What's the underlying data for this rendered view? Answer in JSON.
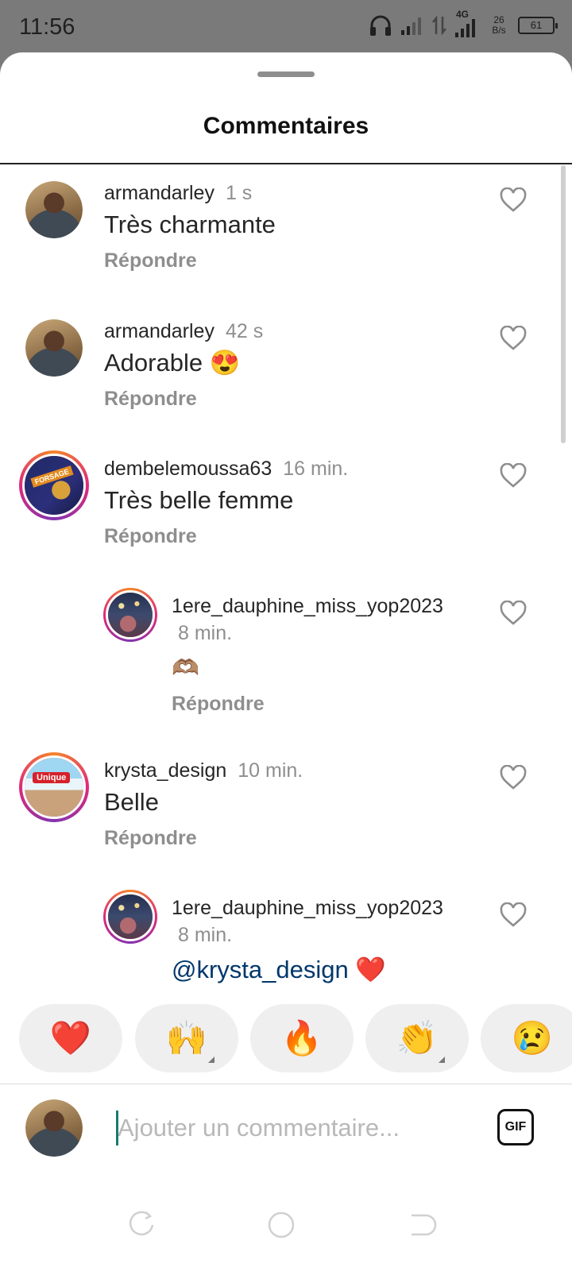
{
  "status_bar": {
    "time": "11:56",
    "network_type": "4G",
    "net_speed_value": "26",
    "net_speed_unit": "B/s",
    "battery_level": "61"
  },
  "sheet": {
    "title": "Commentaires"
  },
  "comments": [
    {
      "username": "armandarley",
      "time": "1 s",
      "text": "Très charmante",
      "reply_label": "Répondre"
    },
    {
      "username": "armandarley",
      "time": "42 s",
      "text": "Adorable 😍",
      "reply_label": "Répondre"
    },
    {
      "username": "dembelemoussa63",
      "time": "16 min.",
      "text": "Très belle femme",
      "reply_label": "Répondre",
      "avatar_text": "FORSAGE"
    },
    {
      "username": "1ere_dauphine_miss_yop2023",
      "time": "8 min.",
      "text": "🫶🏽",
      "reply_label": "Répondre"
    },
    {
      "username": "krysta_design",
      "time": "10 min.",
      "text": "Belle",
      "reply_label": "Répondre",
      "avatar_text": "Unique"
    },
    {
      "username": "1ere_dauphine_miss_yop2023",
      "time": "8 min.",
      "mention": "@krysta_design",
      "text": "❤️"
    }
  ],
  "reactions": [
    "❤️",
    "🙌",
    "🔥",
    "👏",
    "😢"
  ],
  "composer": {
    "placeholder": "Ajouter un commentaire...",
    "gif_label": "GIF"
  },
  "icons": {
    "like": "heart-outline-icon",
    "headset": "headset-icon",
    "signal": "signal-bars-icon",
    "battery": "battery-icon",
    "nav_back": "back-icon",
    "nav_home": "home-icon",
    "nav_recent": "recent-apps-icon"
  },
  "colors": {
    "story_ring_start": "#f58529",
    "story_ring_mid": "#dd2a7b",
    "mention": "#00376b",
    "secondary_text": "#8e8e8e",
    "caret": "#1a7a70"
  }
}
